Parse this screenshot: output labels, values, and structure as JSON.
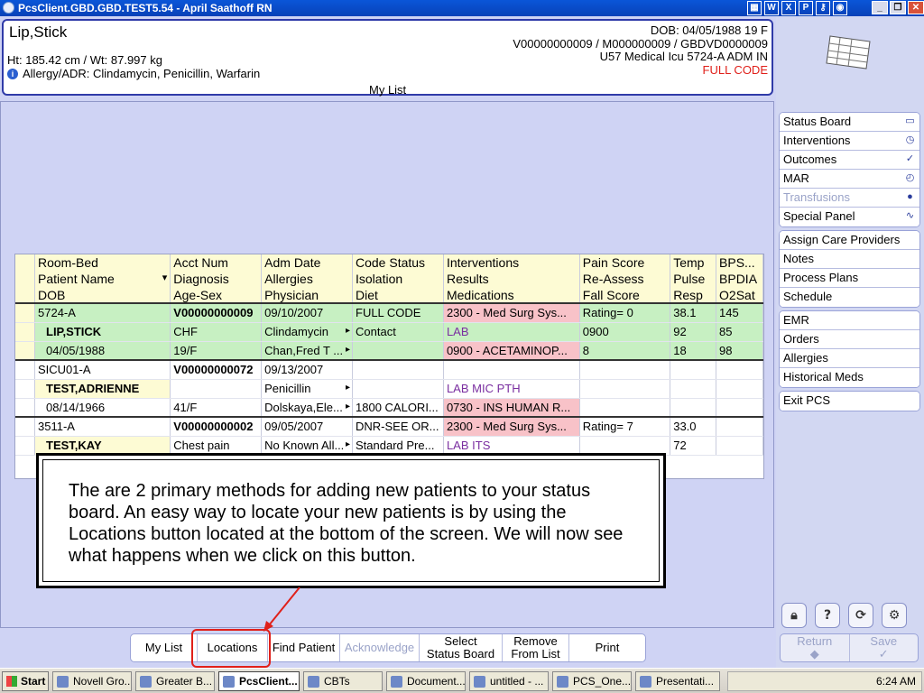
{
  "window": {
    "title": "PcsClient.GBD.GBD.TEST5.54 - April Saathoff RN"
  },
  "patient_header": {
    "name": "Lip,Stick",
    "dob_line": "DOB: 04/05/1988 19 F",
    "ids_line": "V00000000009 / M000000009 / GBDVD0000009",
    "location_line": "U57 Medical Icu  5724-A  ADM IN",
    "code_status": "FULL CODE",
    "ht_wt": "Ht: 185.42 cm / Wt: 87.997 kg",
    "allergy": "Allergy/ADR: Clindamycin, Penicillin, Warfarin",
    "list_name": "My List"
  },
  "right_menu": {
    "group1": [
      "Status Board",
      "Interventions",
      "Outcomes",
      "MAR",
      "Transfusions",
      "Special Panel"
    ],
    "group2": [
      "Assign Care Providers",
      "Notes",
      "Process Plans",
      "Schedule"
    ],
    "group3": [
      "EMR",
      "Orders",
      "Allergies",
      "Historical Meds"
    ],
    "group4": [
      "Exit PCS"
    ],
    "return_label": "Return",
    "save_label": "Save"
  },
  "grid": {
    "headers": [
      [
        "Room-Bed",
        "Acct Num",
        "Adm Date",
        "Code Status",
        "Interventions",
        "Pain Score",
        "Temp",
        "BPS..."
      ],
      [
        "Patient Name",
        "Diagnosis",
        "Allergies",
        "Isolation",
        "Results",
        "Re-Assess",
        "Pulse",
        "BPDIA"
      ],
      [
        "DOB",
        "Age-Sex",
        "Physician",
        "Diet",
        "Medications",
        "Fall Score",
        "Resp",
        "O2Sat"
      ]
    ],
    "patients": [
      {
        "rows": [
          [
            "5724-A",
            "V00000000009",
            "09/10/2007",
            "FULL CODE",
            "2300 - Med Surg Sys...",
            "Rating= 0",
            "38.1",
            "145"
          ],
          [
            "LIP,STICK",
            "CHF",
            "Clindamycin",
            "Contact",
            "LAB",
            "0900",
            "92",
            "85"
          ],
          [
            "04/05/1988",
            "19/F",
            "Chan,Fred T ...",
            "",
            "0900 - ACETAMINOP...",
            "8",
            "18",
            "98"
          ]
        ]
      },
      {
        "rows": [
          [
            "SICU01-A",
            "V00000000072",
            "09/13/2007",
            "",
            "",
            "",
            "",
            ""
          ],
          [
            "TEST,ADRIENNE",
            "",
            "Penicillin",
            "",
            "LAB MIC PTH",
            "",
            "",
            ""
          ],
          [
            "08/14/1966",
            "41/F",
            "Dolskaya,Ele...",
            "1800 CALORI...",
            "0730 - INS HUMAN R...",
            "",
            "",
            ""
          ]
        ]
      },
      {
        "rows": [
          [
            "3511-A",
            "V00000000002",
            "09/05/2007",
            "DNR-SEE OR...",
            "2300 - Med Surg Sys...",
            "Rating= 7",
            "33.0",
            ""
          ],
          [
            "TEST,KAY",
            "Chest pain",
            "No Known All...",
            "Standard Pre...",
            "LAB ITS",
            "",
            "72",
            ""
          ]
        ]
      }
    ]
  },
  "message": "The are 2 primary methods for adding new patients to your status board. An easy way to locate your new patients is by using the Locations button located at the bottom of the screen. We will now see what happens when we click on this button.",
  "bottom_buttons": {
    "my_list": "My List",
    "locations": "Locations",
    "find_patient": "Find Patient",
    "acknowledge": "Acknowledge",
    "select_status_board_1": "Select",
    "select_status_board_2": "Status Board",
    "remove_from_list_1": "Remove",
    "remove_from_list_2": "From List",
    "print": "Print"
  },
  "taskbar": {
    "start": "Start",
    "tasks": [
      "Novell Gro...",
      "Greater B...",
      "PcsClient...",
      "CBTs",
      "Document...",
      "untitled - ...",
      "PCS_One...",
      "Presentati..."
    ],
    "clock": "6:24 AM"
  },
  "colors": {
    "accent": "#2f3aa8",
    "alert": "#e0201a",
    "row_green": "#c7f0c2",
    "row_pink": "#f8c2c8",
    "header_yellow": "#fdfbd4"
  }
}
